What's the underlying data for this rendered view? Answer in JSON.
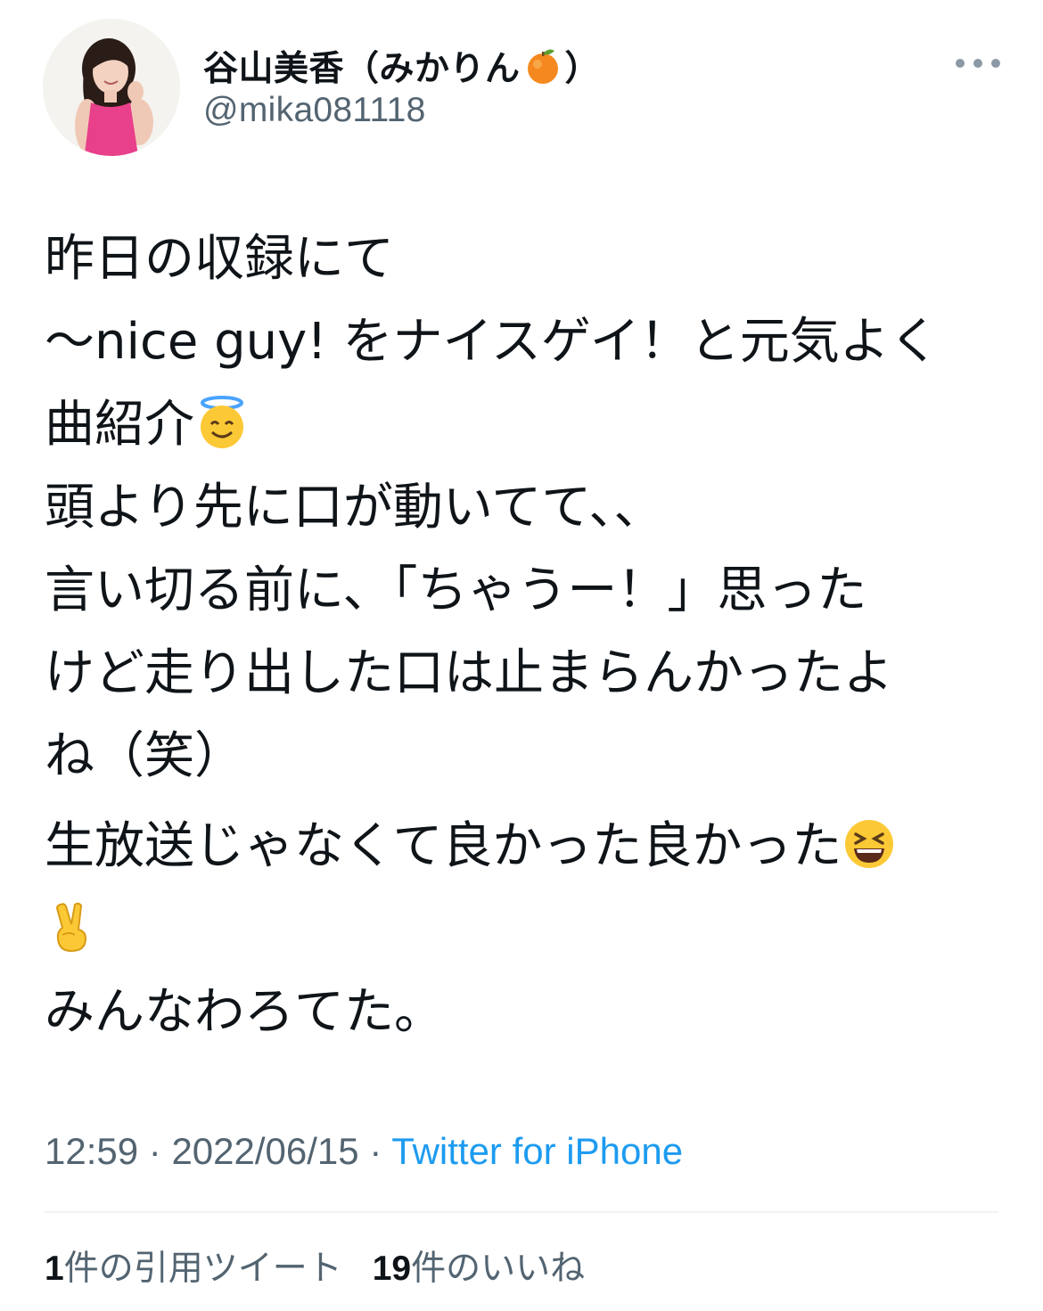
{
  "author": {
    "display_name": "谷山美香（みかりん",
    "name_emoji": "tangerine-emoji",
    "name_suffix": "）",
    "handle": "@mika081118"
  },
  "tweet": {
    "lines": [
      "昨日の収録にて",
      "〜nice guy! をナイスゲイ！と元気よく",
      "曲紹介",
      "頭より先に口が動いてて、、",
      "言い切る前に、「ちゃうー！」思った",
      "けど走り出した口は止まらんかったよ",
      "ね（笑）",
      "生放送じゃなくて良かった良かった",
      "みんなわろてた。"
    ],
    "emojis": [
      "smiling-face-with-halo",
      "grinning-squinting-face",
      "victory-hand"
    ]
  },
  "meta": {
    "time": "12:59",
    "separator": " · ",
    "date": "2022/06/15",
    "source": "Twitter for iPhone"
  },
  "stats": {
    "quote_count": "1",
    "quote_label": "件の引用ツイート",
    "like_count": "19",
    "like_label": "件のいいね"
  },
  "colors": {
    "text_primary": "#0f1419",
    "text_secondary": "#536471",
    "link": "#1d9bf0",
    "divider": "#eff3f4"
  }
}
